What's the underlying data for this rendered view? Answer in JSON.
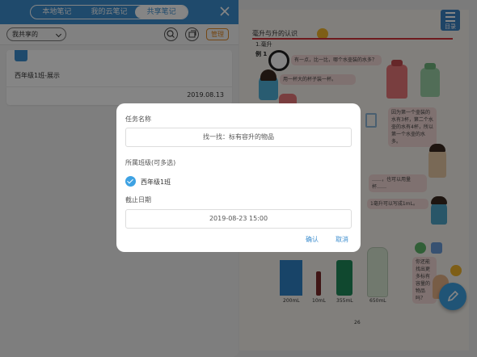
{
  "panel": {
    "tabs": [
      "本地笔记",
      "我的云笔记",
      "共享笔记"
    ],
    "active_tab": 2,
    "filter_value": "我共享的",
    "manage_label": "管理",
    "note": {
      "title": "西年级1班-展示",
      "date": "2019.08.13"
    }
  },
  "book": {
    "menu_label": "目录",
    "chapter_title": "毫升与升的认识",
    "section": "1.毫升",
    "example_label": "例 1",
    "bubble1": "有一点，比一比，哪个水壶装的水多？",
    "bubble2": "用一杯大的杯子装一杯。",
    "bubble3": "因为第一个壶装的水有3杯，第二个水壶的水有4杯，所以第一个水壶的水多。",
    "bubble4": "……，也可以用量杯……",
    "bubble5": "1毫升可以写成1mL。",
    "bubble6": "你还能找出更多标有容量的物品吗？",
    "volumes": [
      "200mL",
      "10mL",
      "355mL",
      "650mL"
    ],
    "page_number": "26"
  },
  "dialog": {
    "task_label": "任务名称",
    "task_value": "找一找：标有容升的物品",
    "class_label": "所属班级(可多选)",
    "class_option": "西年级1班",
    "deadline_label": "截止日期",
    "deadline_value": "2019-08-23 15:00",
    "confirm": "确认",
    "cancel": "取消"
  }
}
